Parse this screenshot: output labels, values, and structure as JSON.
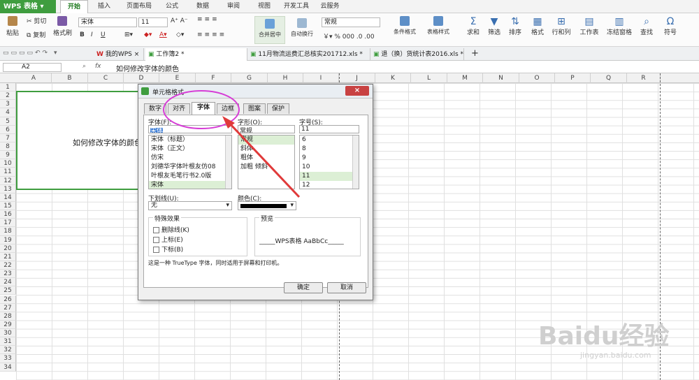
{
  "app": {
    "app_button": "WPS 表格",
    "menu_tabs": [
      "开始",
      "插入",
      "页面布局",
      "公式",
      "数据",
      "审阅",
      "视图",
      "开发工具",
      "云服务"
    ]
  },
  "ribbon": {
    "paste": "粘贴",
    "cut": "剪切",
    "copy": "复制",
    "format_painter": "格式刷",
    "font_name": "宋体",
    "font_size": "11",
    "merge_center": "合并居中",
    "wrap": "自动换行",
    "number_format": "常规",
    "cond_format": "条件格式",
    "table_style": "表格样式",
    "sum": "求和",
    "filter": "筛选",
    "sort": "排序",
    "format": "格式",
    "rowcol": "行和列",
    "worksheet": "工作表",
    "freeze": "冻结窗格",
    "find": "查找",
    "symbol": "符号"
  },
  "doc_tabs": [
    {
      "label": "我的WPS"
    },
    {
      "label": "工作簿2 *"
    },
    {
      "label": "11月物流运费汇总核实201712.xls *"
    },
    {
      "label": "退（换）货统计表2016.xls *"
    }
  ],
  "formula_bar": {
    "cell_ref": "A2",
    "fx": "fx",
    "content": "如何修改字体的颜色"
  },
  "columns": [
    "A",
    "B",
    "C",
    "D",
    "E",
    "F",
    "G",
    "H",
    "I",
    "J",
    "K",
    "L",
    "M",
    "N",
    "O",
    "P",
    "Q",
    "R"
  ],
  "rows": [
    "1",
    "2",
    "3",
    "4",
    "5",
    "6",
    "7",
    "8",
    "9",
    "10",
    "11",
    "12",
    "13",
    "14",
    "15",
    "16",
    "17",
    "18",
    "19",
    "20",
    "21",
    "22",
    "23",
    "24",
    "25",
    "26",
    "27",
    "28",
    "29",
    "30",
    "31",
    "32",
    "33",
    "34"
  ],
  "cell_text": "如何修改字体的颜色",
  "dialog": {
    "title": "单元格格式",
    "close": "×",
    "tabs": [
      "数字",
      "对齐",
      "字体",
      "边框",
      "图案",
      "保护"
    ],
    "font_label": "字体(F):",
    "font_value": "宋体",
    "font_list": [
      "宋体（标题）",
      "宋体（正文）",
      "仿宋",
      "刘德华字体叶根友仿08",
      "叶根友毛笔行书2.0版",
      "宋体"
    ],
    "style_label": "字形(O):",
    "style_value": "常规",
    "style_list": [
      "常规",
      "斜体",
      "粗体",
      "加粗 倾斜"
    ],
    "size_label": "字号(S):",
    "size_value": "11",
    "size_list": [
      "6",
      "8",
      "9",
      "10",
      "11",
      "12"
    ],
    "underline_label": "下划线(U):",
    "underline_value": "无",
    "color_label": "颜色(C):",
    "effects_title": "特殊效果",
    "strike": "删除线(K)",
    "superscript": "上标(E)",
    "subscript": "下标(B)",
    "preview_title": "预览",
    "preview_text": "_____WPS表格  AaBbCc_____",
    "note": "这是一种 TrueType 字体，同时适用于屏幕和打印机。",
    "ok": "确定",
    "cancel": "取消"
  },
  "watermark": {
    "text": "Baidu经验",
    "sub": "jingyan.baidu.com"
  },
  "colors": {
    "accent": "#3f9d3f",
    "annotation": "#d63dd6",
    "arrow": "#e03a3a"
  }
}
